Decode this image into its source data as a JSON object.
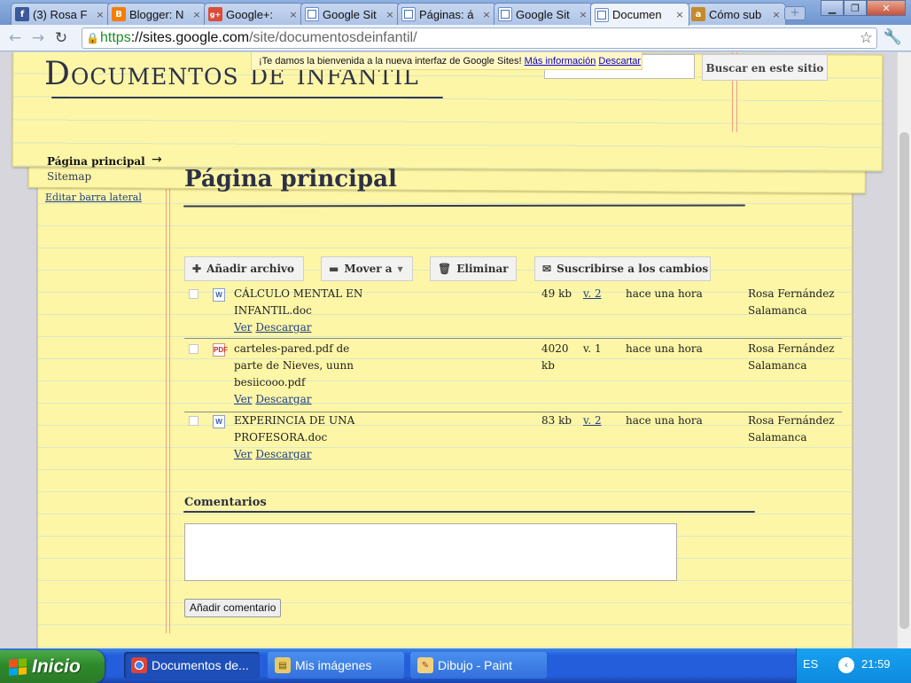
{
  "browser": {
    "tabs": [
      {
        "label": "(3) Rosa F",
        "icon": "facebook-icon"
      },
      {
        "label": "Blogger: N",
        "icon": "blogger-icon"
      },
      {
        "label": "Google+:",
        "icon": "google-plus-icon"
      },
      {
        "label": "Google Sit",
        "icon": "google-sites-icon"
      },
      {
        "label": "Páginas: á",
        "icon": "google-sites-icon"
      },
      {
        "label": "Google Sit",
        "icon": "google-sites-icon"
      },
      {
        "label": "Documen",
        "icon": "google-sites-icon",
        "active": true
      },
      {
        "label": "Cómo sub",
        "icon": "ask-icon"
      }
    ],
    "tab_close_glyph": "×",
    "new_tab_glyph": "+",
    "url_scheme": "https",
    "url_host": "://sites.google.com",
    "url_path": "/site/documentosdeinfantil/"
  },
  "notice": {
    "text": "¡Te damos la bienvenida a la nueva interfaz de Google Sites!",
    "more_link": "Más información",
    "dismiss_link": "Descartar"
  },
  "site": {
    "title": "Documentos de infantil",
    "search_button": "Buscar en este sitio"
  },
  "sidebar": {
    "items": [
      {
        "label": "Página principal",
        "current": true
      },
      {
        "label": "Sitemap"
      }
    ],
    "edit_link": "Editar barra lateral"
  },
  "main": {
    "title": "Página principal",
    "toolbar": {
      "add": "Añadir archivo",
      "move": "Mover a",
      "delete": "Eliminar",
      "subscribe": "Suscribirse a los cambios"
    },
    "files": [
      {
        "name": "CÁLCULO MENTAL EN INFANTIL.doc",
        "type": "doc",
        "size": "49 kb",
        "version": "v. 2",
        "version_link": true,
        "modified": "hace una hora",
        "author": "Rosa Fernández Salamanca",
        "view": "Ver",
        "download": "Descargar"
      },
      {
        "name": "carteles-pared.pdf de parte de Nieves, uunn besiicooo.pdf",
        "type": "pdf",
        "size": "4020 kb",
        "version": "v. 1",
        "version_link": false,
        "modified": "hace una hora",
        "author": "Rosa Fernández Salamanca",
        "view": "Ver",
        "download": "Descargar"
      },
      {
        "name": "EXPERINCIA DE UNA PROFESORA.doc",
        "type": "doc",
        "size": "83 kb",
        "version": "v. 2",
        "version_link": true,
        "modified": "hace una hora",
        "author": "Rosa Fernández Salamanca",
        "view": "Ver",
        "download": "Descargar"
      }
    ],
    "comments_title": "Comentarios",
    "comment_button": "Añadir comentario"
  },
  "taskbar": {
    "start_label": "Inicio",
    "tasks": [
      {
        "label": "Documentos de...",
        "active": true,
        "icon": "chrome-icon"
      },
      {
        "label": "Mis imágenes",
        "active": false,
        "icon": "folder-icon"
      },
      {
        "label": "Dibujo - Paint",
        "active": false,
        "icon": "paint-icon"
      }
    ],
    "language": "ES",
    "clock": "21:59"
  },
  "colors": {
    "paper": "#fdf6a6",
    "ink": "#2d3146",
    "link": "#1e3f87",
    "margin_line": "#ef9f85",
    "xp_blue": "#245edb",
    "xp_green": "#2d8a2b"
  }
}
